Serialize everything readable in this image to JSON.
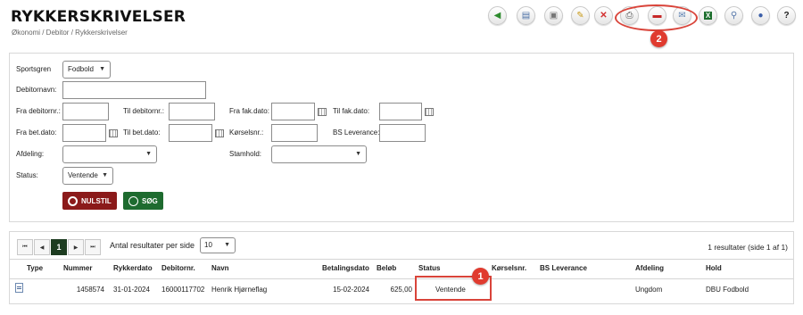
{
  "header": {
    "title": "RYKKERSKRIVELSER",
    "breadcrumb": "Økonomi / Debitor / Rykkerskrivelser"
  },
  "toolbar": {
    "glyphs": {
      "back": "◀",
      "document": "▤",
      "lock": "▣",
      "edit": "✎",
      "delete": "✕",
      "print": "⎙",
      "pdf": "▬",
      "email": "✉",
      "excel": "X",
      "search": "⚲",
      "info": "●",
      "help": "?"
    }
  },
  "annotations": {
    "marker_1": "1",
    "marker_2": "2",
    "color": "#d9443a"
  },
  "filters": {
    "sportsgren_label": "Sportsgren",
    "sportsgren_value": "Fodbold",
    "debitornavn_label": "Debitornavn:",
    "fra_debitornr_label": "Fra debitornr.:",
    "til_debitornr_label": "Til debitornr.:",
    "fra_fak_dato_label": "Fra fak.dato:",
    "til_fak_dato_label": "Til fak.dato:",
    "fra_bet_dato_label": "Fra bet.dato:",
    "til_bet_dato_label": "Til bet.dato:",
    "koerselsnr_label": "Kørselsnr.:",
    "bs_leverance_label": "BS Leverance:",
    "afdeling_label": "Afdeling:",
    "afdeling_value": "",
    "stamhold_label": "Stamhold:",
    "stamhold_value": "",
    "status_label": "Status:",
    "status_value": "Ventende",
    "dropdown_arrow": "▼"
  },
  "actions": {
    "reset_label": "NULSTIL",
    "search_label": "SØG",
    "reset_color": "#8b1a1a",
    "search_color": "#1e6b2f"
  },
  "results": {
    "pager": {
      "first": "⏮",
      "prev": "◀",
      "current_page": "1",
      "next": "▶",
      "last": "⏭"
    },
    "per_page_label": "Antal resultater per side",
    "per_page_value": "10",
    "summary": "1 resultater (side 1 af 1)",
    "columns": [
      "Type",
      "Nummer",
      "Rykkerdato",
      "Debitornr.",
      "Navn",
      "Betalingsdato",
      "Beløb",
      "Status",
      "Kørselsnr.",
      "BS Leverance",
      "Afdeling",
      "Hold"
    ],
    "rows": [
      {
        "nummer": "1458574",
        "rykkerdato": "31-01-2024",
        "debitornr": "16000117702",
        "navn": "Henrik Hjørneflag",
        "betalingsdato": "15-02-2024",
        "beloeb": "625,00",
        "status": "Ventende",
        "koerselsnr": "",
        "bs_leverance": "",
        "afdeling": "Ungdom",
        "hold": "DBU Fodbold"
      }
    ]
  }
}
